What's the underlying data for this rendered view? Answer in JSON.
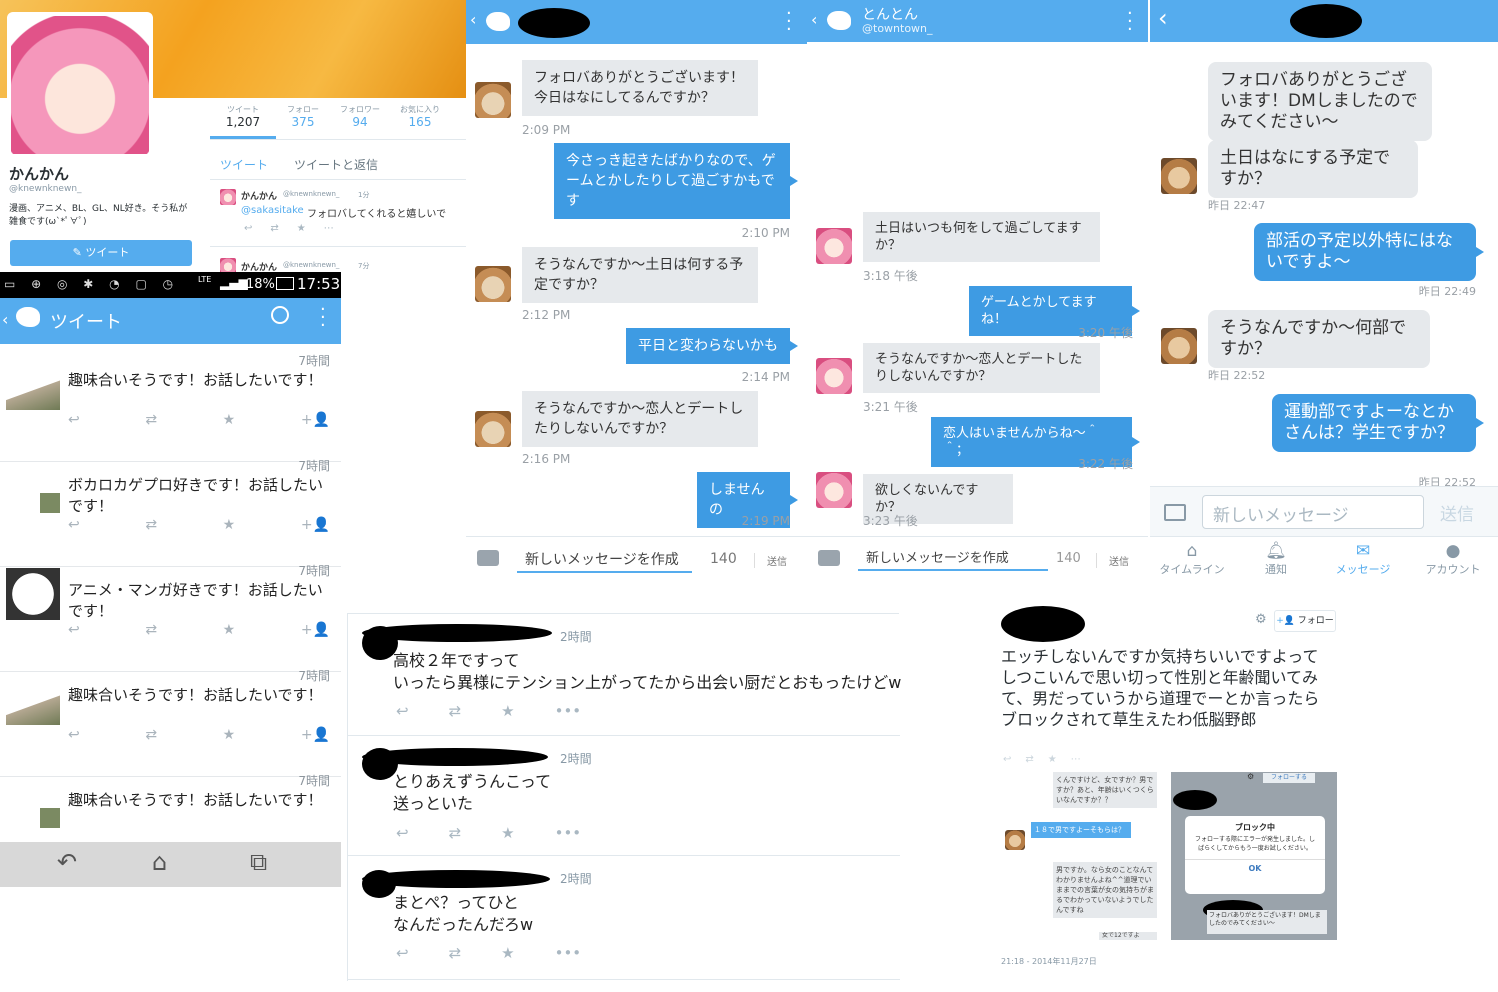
{
  "profile": {
    "stats": [
      {
        "label": "ツイート",
        "value": "1,207"
      },
      {
        "label": "フォロー",
        "value": "375"
      },
      {
        "label": "フォロワー",
        "value": "94"
      },
      {
        "label": "お気に入り",
        "value": "165"
      }
    ],
    "name": "かんかん",
    "handle": "@knewnknewn_",
    "bio": "漫画、アニメ、BL、GL、NL好き。そう私が雑食です(ω`*ﾟ∀ﾟ)",
    "tweet_button": "ツイート",
    "tabs": [
      "ツイート",
      "ツイートと返信"
    ],
    "tweets": [
      {
        "name": "かんかん",
        "handle": "@knewnknewn_",
        "time": "1分",
        "mention": "@sakasitake",
        "text": "フォロバしてくれると嬉しいで"
      },
      {
        "name": "かんかん",
        "handle": "@knewnknewn_",
        "time": "7分"
      }
    ]
  },
  "android": {
    "status": {
      "battery": "18%",
      "time": "17:53",
      "network": "LTE"
    },
    "header": "ツイート",
    "rows": [
      {
        "time": "7時間",
        "text": "趣味合いそうです！お話したいです！"
      },
      {
        "time": "7時間",
        "text": "ボカロカゲプロ好きです！お話したいです！"
      },
      {
        "time": "7時間",
        "text": "アニメ・マンガ好きです！お話したいです！"
      },
      {
        "time": "7時間",
        "text": "趣味合いそうです！お話したいです！"
      },
      {
        "time": "7時間",
        "text": "趣味合いそうです！お話したいです！"
      }
    ]
  },
  "dm1": {
    "messages": [
      {
        "side": "left",
        "text": "フォロバありがとうございます！今日はなにしてるんですか？",
        "time": "2:09 PM"
      },
      {
        "side": "right",
        "text": "今さっき起きたばかりなので、ゲームとかしたりして過ごすかもです",
        "time": "2:10 PM"
      },
      {
        "side": "left",
        "text": "そうなんですか〜土日は何する予定ですか？",
        "time": "2:12 PM"
      },
      {
        "side": "right",
        "text": "平日と変わらないかも",
        "time": "2:14 PM"
      },
      {
        "side": "left",
        "text": "そうなんですか〜恋人とデートしたりしないんですか？",
        "time": "2:16 PM"
      },
      {
        "side": "right",
        "text": "しませんの",
        "time": "2:19 PM"
      }
    ],
    "compose_placeholder": "新しいメッセージを作成",
    "count": "140",
    "send": "送信"
  },
  "dm2": {
    "name": "とんとん",
    "handle": "@towntown_",
    "messages": [
      {
        "side": "left",
        "text": "土日はいつも何をして過ごしてますか？",
        "time": "3:18 午後"
      },
      {
        "side": "right",
        "text": "ゲームとかしてますね！",
        "time": "3:20 午後"
      },
      {
        "side": "left",
        "text": "そうなんですか〜恋人とデートしたりしないんですか？",
        "time": "3:21 午後"
      },
      {
        "side": "right",
        "text": "恋人はいませんからね〜＾＾；",
        "time": "3:22 午後"
      },
      {
        "side": "left",
        "text": "欲しくないんですか？",
        "time": "3:23 午後"
      }
    ],
    "compose_placeholder": "新しいメッセージを作成",
    "count": "140",
    "send": "送信"
  },
  "dm3": {
    "messages": [
      {
        "side": "left",
        "text": "フォロバありがとうございます！DMしましたのでみてください〜",
        "time": ""
      },
      {
        "side": "left",
        "text": "土日はなにする予定ですか？",
        "time": "昨日 22:47"
      },
      {
        "side": "right",
        "text": "部活の予定以外特にはないですよ〜",
        "time": "昨日 22:49"
      },
      {
        "side": "left",
        "text": "そうなんですか〜何部ですか？",
        "time": "昨日 22:52"
      },
      {
        "side": "right",
        "text": "運動部ですよーなとかさんは？学生ですか？",
        "time": "昨日 22:52"
      }
    ],
    "input_placeholder": "新しいメッセージ",
    "send": "送信",
    "nav": [
      "タイムライン",
      "通知",
      "メッセージ",
      "アカウント"
    ]
  },
  "replies": [
    {
      "time": "2時間",
      "lines": [
        "高校２年ですって",
        "いったら異様にテンション上がってたから出会い厨だとおもったけどw"
      ]
    },
    {
      "time": "2時間",
      "lines": [
        "とりあえずうんこって",
        "送っといた"
      ]
    },
    {
      "time": "2時間",
      "lines": [
        "まとぺ？ってひと",
        "なんだったんだろw"
      ]
    }
  ],
  "bottom_right": {
    "follow": "フォロー",
    "text": "エッチしないんですか気持ちいいですよってしつこいんで思い切って性別と年齢聞いてみて、男だっていうから道理でーとか言ったらブロックされて草生えたわ低脳野郎",
    "footer": "21:18 - 2014年11月27日",
    "thumb_msgs": [
      "くんですけど、女ですか？男ですか？あと、年齢はいくつくらいなんですか？？",
      "１８で男ですよーそもらは？",
      "男ですか。なら女のことなんてわかりませんよね^^道理でいままでの言葉が女の気持ちがまるでわかっていないようでしたんですね",
      "女で12ですよ"
    ],
    "dialog_title": "ブロック中",
    "dialog_text": "フォローする際にエラーが発生しました。しばらくしてからもう一度お試しください。",
    "dialog_ok": "OK",
    "thumb_follow": "フォローする",
    "thumb_tail": "フォロバありがとうございます！DMしましたのでみてください〜"
  },
  "colors": {
    "twitter_blue": "#55acee",
    "bubble_blue": "#3e9be3",
    "bubble_grey": "#e6e9ec"
  }
}
